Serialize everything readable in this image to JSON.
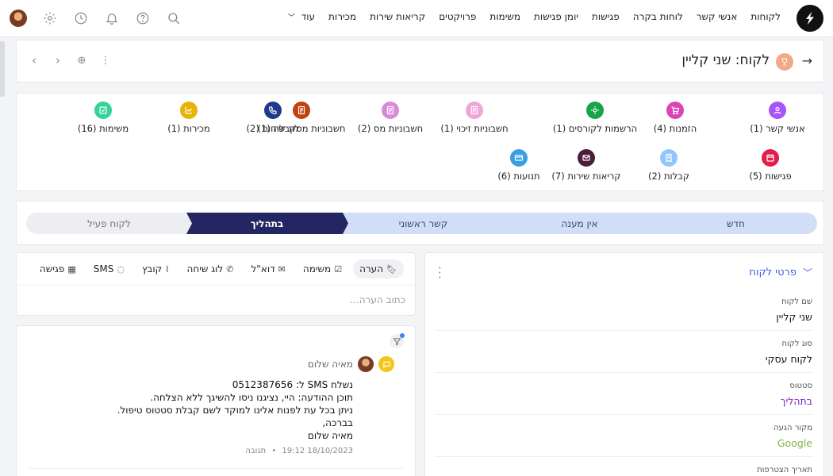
{
  "nav": {
    "items": [
      "לקוחות",
      "אנשי קשר",
      "לוחות בקרה",
      "פגישות",
      "יומן פגישות",
      "משימות",
      "פרויקטים",
      "קריאות שירות",
      "מכירות",
      "עוד"
    ]
  },
  "header": {
    "title": "לקוח: שני קליין"
  },
  "related": [
    {
      "label": "אנשי קשר (1)",
      "icon": "user-icon",
      "color": "#a855f7"
    },
    {
      "label": "הזמנות (4)",
      "icon": "cart-icon",
      "color": "#d946b3"
    },
    {
      "label": "הרשמות לקורסים (1)",
      "icon": "gear-icon",
      "color": "#16a34a"
    },
    {
      "label": "חשבוניות זיכוי (1)",
      "icon": "doc-icon",
      "color": "#f0a6d6"
    },
    {
      "label": "חשבוניות מס (2)",
      "icon": "doc-icon",
      "color": "#d98ad9"
    },
    {
      "label": "חשבוניות מסקבלה (1)",
      "icon": "doc-icon",
      "color": "#c2410c"
    },
    {
      "label": "לוג שיחות (2)",
      "icon": "phone-icon",
      "color": "#1e3a8a"
    },
    {
      "label": "מכירות (1)",
      "icon": "chart-icon",
      "color": "#eab308"
    },
    {
      "label": "משימות (16)",
      "icon": "check-icon",
      "color": "#34d399"
    },
    {
      "label": "פגישות (5)",
      "icon": "calendar-icon",
      "color": "#e11d48"
    },
    {
      "label": "קבלות (2)",
      "icon": "receipt-icon",
      "color": "#93c5fd"
    },
    {
      "label": "קריאות שירות (7)",
      "icon": "mail-icon",
      "color": "#4c1d3d"
    },
    {
      "label": "תנועות (6)",
      "icon": "card-icon",
      "color": "#3b9ee5"
    }
  ],
  "stages": [
    "חדש",
    "אין מענה",
    "קשר ראשוני",
    "בתהליך",
    "לקוח פעיל"
  ],
  "composer": {
    "tabs": [
      "הערה",
      "משימה",
      "דוא\"ל",
      "לוג שיחה",
      "קובץ",
      "SMS",
      "פגישה"
    ],
    "placeholder": "כתוב הערה..."
  },
  "feed": {
    "author": "מאיה שלום",
    "lines": [
      "נשלח SMS ל: 0512387656",
      "תוכן ההודעה: היי, נציגנו ניסו להשיגך ללא הצלחה.",
      "ניתן בכל עת לפנות אלינו למוקד לשם קבלת סטטוס טיפול.",
      "בברכה,",
      "מאיה שלום"
    ],
    "timestamp": "18/10/2023 19:12",
    "reply": "תגובה"
  },
  "details": {
    "title": "פרטי לקוח",
    "fields": [
      {
        "label": "שם לקוח",
        "value": "שני קליין",
        "color": "#111111"
      },
      {
        "label": "סוג לקוח",
        "value": "לקוח עסקי",
        "color": "#111111"
      },
      {
        "label": "סטטוס",
        "value": "בתהליך",
        "color": "#7e22ce"
      },
      {
        "label": "מקור הגעה",
        "value": "Google",
        "color": "#7cb342"
      },
      {
        "label": "תאריך הצטרפות",
        "value": "",
        "color": "#111111"
      }
    ]
  }
}
